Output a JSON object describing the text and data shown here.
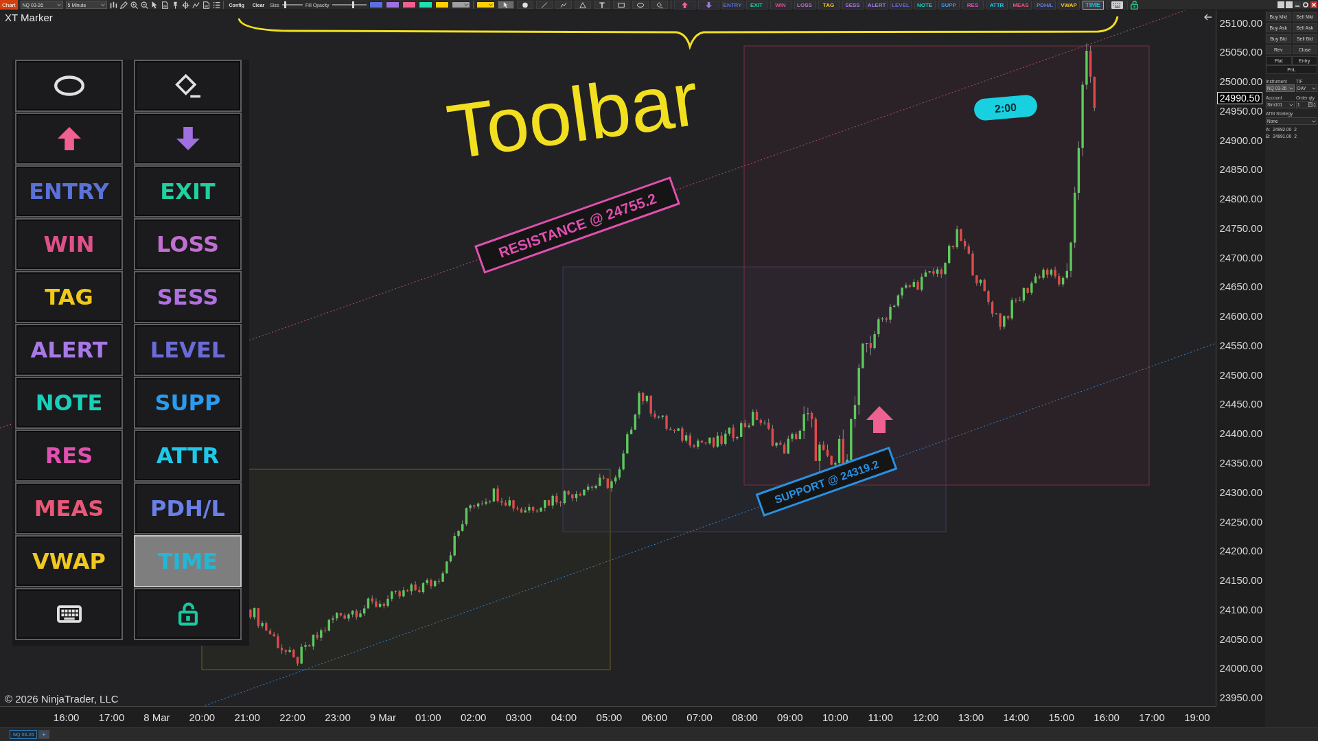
{
  "toolbar": {
    "chart_tab": "Chart",
    "instrument": "NQ 03-26",
    "interval": "5 Minute",
    "tools": [
      {
        "kind": "bars"
      },
      {
        "kind": "pencil"
      },
      {
        "kind": "zoom-in"
      },
      {
        "kind": "zoom-out"
      },
      {
        "kind": "pointer"
      },
      {
        "kind": "page"
      },
      {
        "kind": "pin"
      },
      {
        "kind": "crosshair"
      },
      {
        "kind": "polyline"
      },
      {
        "kind": "page"
      },
      {
        "kind": "list"
      }
    ],
    "config_button": "Config",
    "clear_button": "Clear",
    "size_label": "Size",
    "size": {
      "level": 0.15
    },
    "fill_opacity_label": "Fill Opacity",
    "fill_opacity": {
      "level": 0.6
    },
    "swatches": [
      {
        "color": "#5b6fe0",
        "dropdown": false
      },
      {
        "color": "#a070e0",
        "dropdown": false
      },
      {
        "color": "#f06090",
        "dropdown": false
      },
      {
        "color": "#20e0b0",
        "dropdown": false
      },
      {
        "color": "#ffd000",
        "dropdown": false
      },
      {
        "color": "#a0a0a0",
        "dropdown": true
      }
    ],
    "line_color": {
      "color": "#ffd000",
      "dropdown": true
    },
    "draw_tools": [
      {
        "kind": "pointer",
        "selected": true
      },
      {
        "kind": "dot",
        "selected": false
      },
      {
        "kind": "line",
        "selected": false
      },
      {
        "kind": "polyline",
        "selected": false
      },
      {
        "kind": "triangle",
        "selected": false
      },
      {
        "kind": "text",
        "selected": false
      },
      {
        "kind": "rect",
        "selected": false
      },
      {
        "kind": "ellipse",
        "selected": false
      },
      {
        "kind": "eraser",
        "selected": false
      }
    ],
    "markers": [
      {
        "kind": "arrow-up",
        "color": "#f06090",
        "selected": false
      },
      {
        "kind": "arrow-down",
        "color": "#a070e0",
        "selected": false
      },
      {
        "kind": "label",
        "text": "ENTRY",
        "color": "#5a72d8",
        "selected": false
      },
      {
        "kind": "label",
        "text": "EXIT",
        "color": "#20d0a0",
        "selected": false
      },
      {
        "kind": "label",
        "text": "WIN",
        "color": "#e0508a",
        "selected": false
      },
      {
        "kind": "label",
        "text": "LOSS",
        "color": "#c070d0",
        "selected": false
      },
      {
        "kind": "label",
        "text": "TAG",
        "color": "#f0c818",
        "selected": false
      },
      {
        "kind": "label",
        "text": "SESS",
        "color": "#b070e0",
        "selected": false
      },
      {
        "kind": "label",
        "text": "ALERT",
        "color": "#a878e8",
        "selected": false
      },
      {
        "kind": "label",
        "text": "LEVEL",
        "color": "#6a6ad8",
        "selected": false
      },
      {
        "kind": "label",
        "text": "NOTE",
        "color": "#18d0b8",
        "selected": false
      },
      {
        "kind": "label",
        "text": "SUPP",
        "color": "#2a9cf0",
        "selected": false
      },
      {
        "kind": "label",
        "text": "RES",
        "color": "#e050b0",
        "selected": false
      },
      {
        "kind": "label",
        "text": "ATTR",
        "color": "#20c8e8",
        "selected": false
      },
      {
        "kind": "label",
        "text": "MEAS",
        "color": "#e85878",
        "selected": false
      },
      {
        "kind": "label",
        "text": "PDH/L",
        "color": "#6a80e8",
        "selected": false
      },
      {
        "kind": "label",
        "text": "VWAP",
        "color": "#f0c820",
        "selected": false
      },
      {
        "kind": "label",
        "text": "TIME",
        "color": "#20b8d8",
        "selected": true
      },
      {
        "kind": "keyboard",
        "color": "#d0d0d0",
        "selected": false
      }
    ],
    "lock": {
      "kind": "lock",
      "color": "#20c080"
    }
  },
  "chart": {
    "title": "XT Marker",
    "handwriting": "Toolbar",
    "resistance_label": "RESISTANCE @ 24755.2",
    "support_label": "SUPPORT @ 24319.2",
    "timer": "2:00",
    "copyright": "© 2026 NinjaTrader, LLC",
    "price_labels": [
      "25100.00",
      "25050.00",
      "25000.00",
      "24950.00",
      "24900.00",
      "24850.00",
      "24800.00",
      "24750.00",
      "24700.00",
      "24650.00",
      "24600.00",
      "24550.00",
      "24500.00",
      "24450.00",
      "24400.00",
      "24350.00",
      "24300.00",
      "24250.00",
      "24200.00",
      "24150.00",
      "24100.00",
      "24050.00",
      "24000.00",
      "23950.00"
    ],
    "current_price": "24990.50",
    "time_labels": [
      "16:00",
      "17:00",
      "8 Mar",
      "20:00",
      "21:00",
      "22:00",
      "23:00",
      "9 Mar",
      "01:00",
      "02:00",
      "03:00",
      "04:00",
      "05:00",
      "06:00",
      "07:00",
      "08:00",
      "09:00",
      "10:00",
      "11:00",
      "12:00",
      "13:00",
      "14:00",
      "15:00",
      "16:00",
      "17:00",
      "19:00"
    ]
  },
  "palette": {
    "buttons": [
      {
        "kind": "ellipse",
        "color": "#e0e0e0",
        "selected": false
      },
      {
        "kind": "eraser",
        "color": "#e0e0e0",
        "selected": false
      },
      {
        "kind": "arrow-up",
        "color": "#f06090",
        "selected": false
      },
      {
        "kind": "arrow-down",
        "color": "#a070e0",
        "selected": false
      },
      {
        "kind": "label",
        "text": "ENTRY",
        "color": "#5a72d8",
        "selected": false
      },
      {
        "kind": "label",
        "text": "EXIT",
        "color": "#20d0a0",
        "selected": false
      },
      {
        "kind": "label",
        "text": "WIN",
        "color": "#e0508a",
        "selected": false
      },
      {
        "kind": "label",
        "text": "LOSS",
        "color": "#c070d0",
        "selected": false
      },
      {
        "kind": "label",
        "text": "TAG",
        "color": "#f0c818",
        "selected": false
      },
      {
        "kind": "label",
        "text": "SESS",
        "color": "#b070e0",
        "selected": false
      },
      {
        "kind": "label",
        "text": "ALERT",
        "color": "#a878e8",
        "selected": false
      },
      {
        "kind": "label",
        "text": "LEVEL",
        "color": "#6a6ad8",
        "selected": false
      },
      {
        "kind": "label",
        "text": "NOTE",
        "color": "#18d0b8",
        "selected": false
      },
      {
        "kind": "label",
        "text": "SUPP",
        "color": "#2a9cf0",
        "selected": false
      },
      {
        "kind": "label",
        "text": "RES",
        "color": "#e050b0",
        "selected": false
      },
      {
        "kind": "label",
        "text": "ATTR",
        "color": "#20c8e8",
        "selected": false
      },
      {
        "kind": "label",
        "text": "MEAS",
        "color": "#e85878",
        "selected": false
      },
      {
        "kind": "label",
        "text": "PDH/L",
        "color": "#6a80e8",
        "selected": false
      },
      {
        "kind": "label",
        "text": "VWAP",
        "color": "#f0c820",
        "selected": false
      },
      {
        "kind": "label",
        "text": "TIME",
        "color": "#20b8d8",
        "selected": true
      },
      {
        "kind": "keyboard",
        "color": "#e0e0e0",
        "selected": false
      },
      {
        "kind": "lock",
        "color": "#18c8a0",
        "selected": false
      }
    ]
  },
  "trade_panel": {
    "order_buttons": [
      {
        "label": "Buy Mkt"
      },
      {
        "label": "Sell Mkt"
      },
      {
        "label": "Buy Ask"
      },
      {
        "label": "Sell Ask"
      },
      {
        "label": "Buy Bid"
      },
      {
        "label": "Sell Bid"
      },
      {
        "label": "Rev"
      },
      {
        "label": "Close"
      }
    ],
    "position_buttons": [
      {
        "label": "Flat"
      },
      {
        "label": "Entry"
      }
    ],
    "pnl": "PnL",
    "fields": [
      {
        "kind": "dropdown",
        "label": "Instrument",
        "value": "NQ 03-26",
        "disabled": true
      },
      {
        "kind": "dropdown",
        "label": "TIF",
        "value": "DAY",
        "disabled": false
      },
      {
        "kind": "dropdown",
        "label": "Account",
        "value": "Sim101",
        "disabled": false
      },
      {
        "kind": "spinner",
        "label": "Order qty",
        "value": "1",
        "disabled": false
      }
    ],
    "atm_label": "ATM Strategy",
    "atm_value": "None",
    "quotes": [
      {
        "side": "A:",
        "price": "24992.00",
        "size": "2"
      },
      {
        "side": "B:",
        "price": "24991.00",
        "size": "2"
      }
    ]
  },
  "bottom_tabs": {
    "tabs": [
      {
        "label": "NQ 03-26",
        "selected": true
      }
    ],
    "add_button": "+"
  }
}
